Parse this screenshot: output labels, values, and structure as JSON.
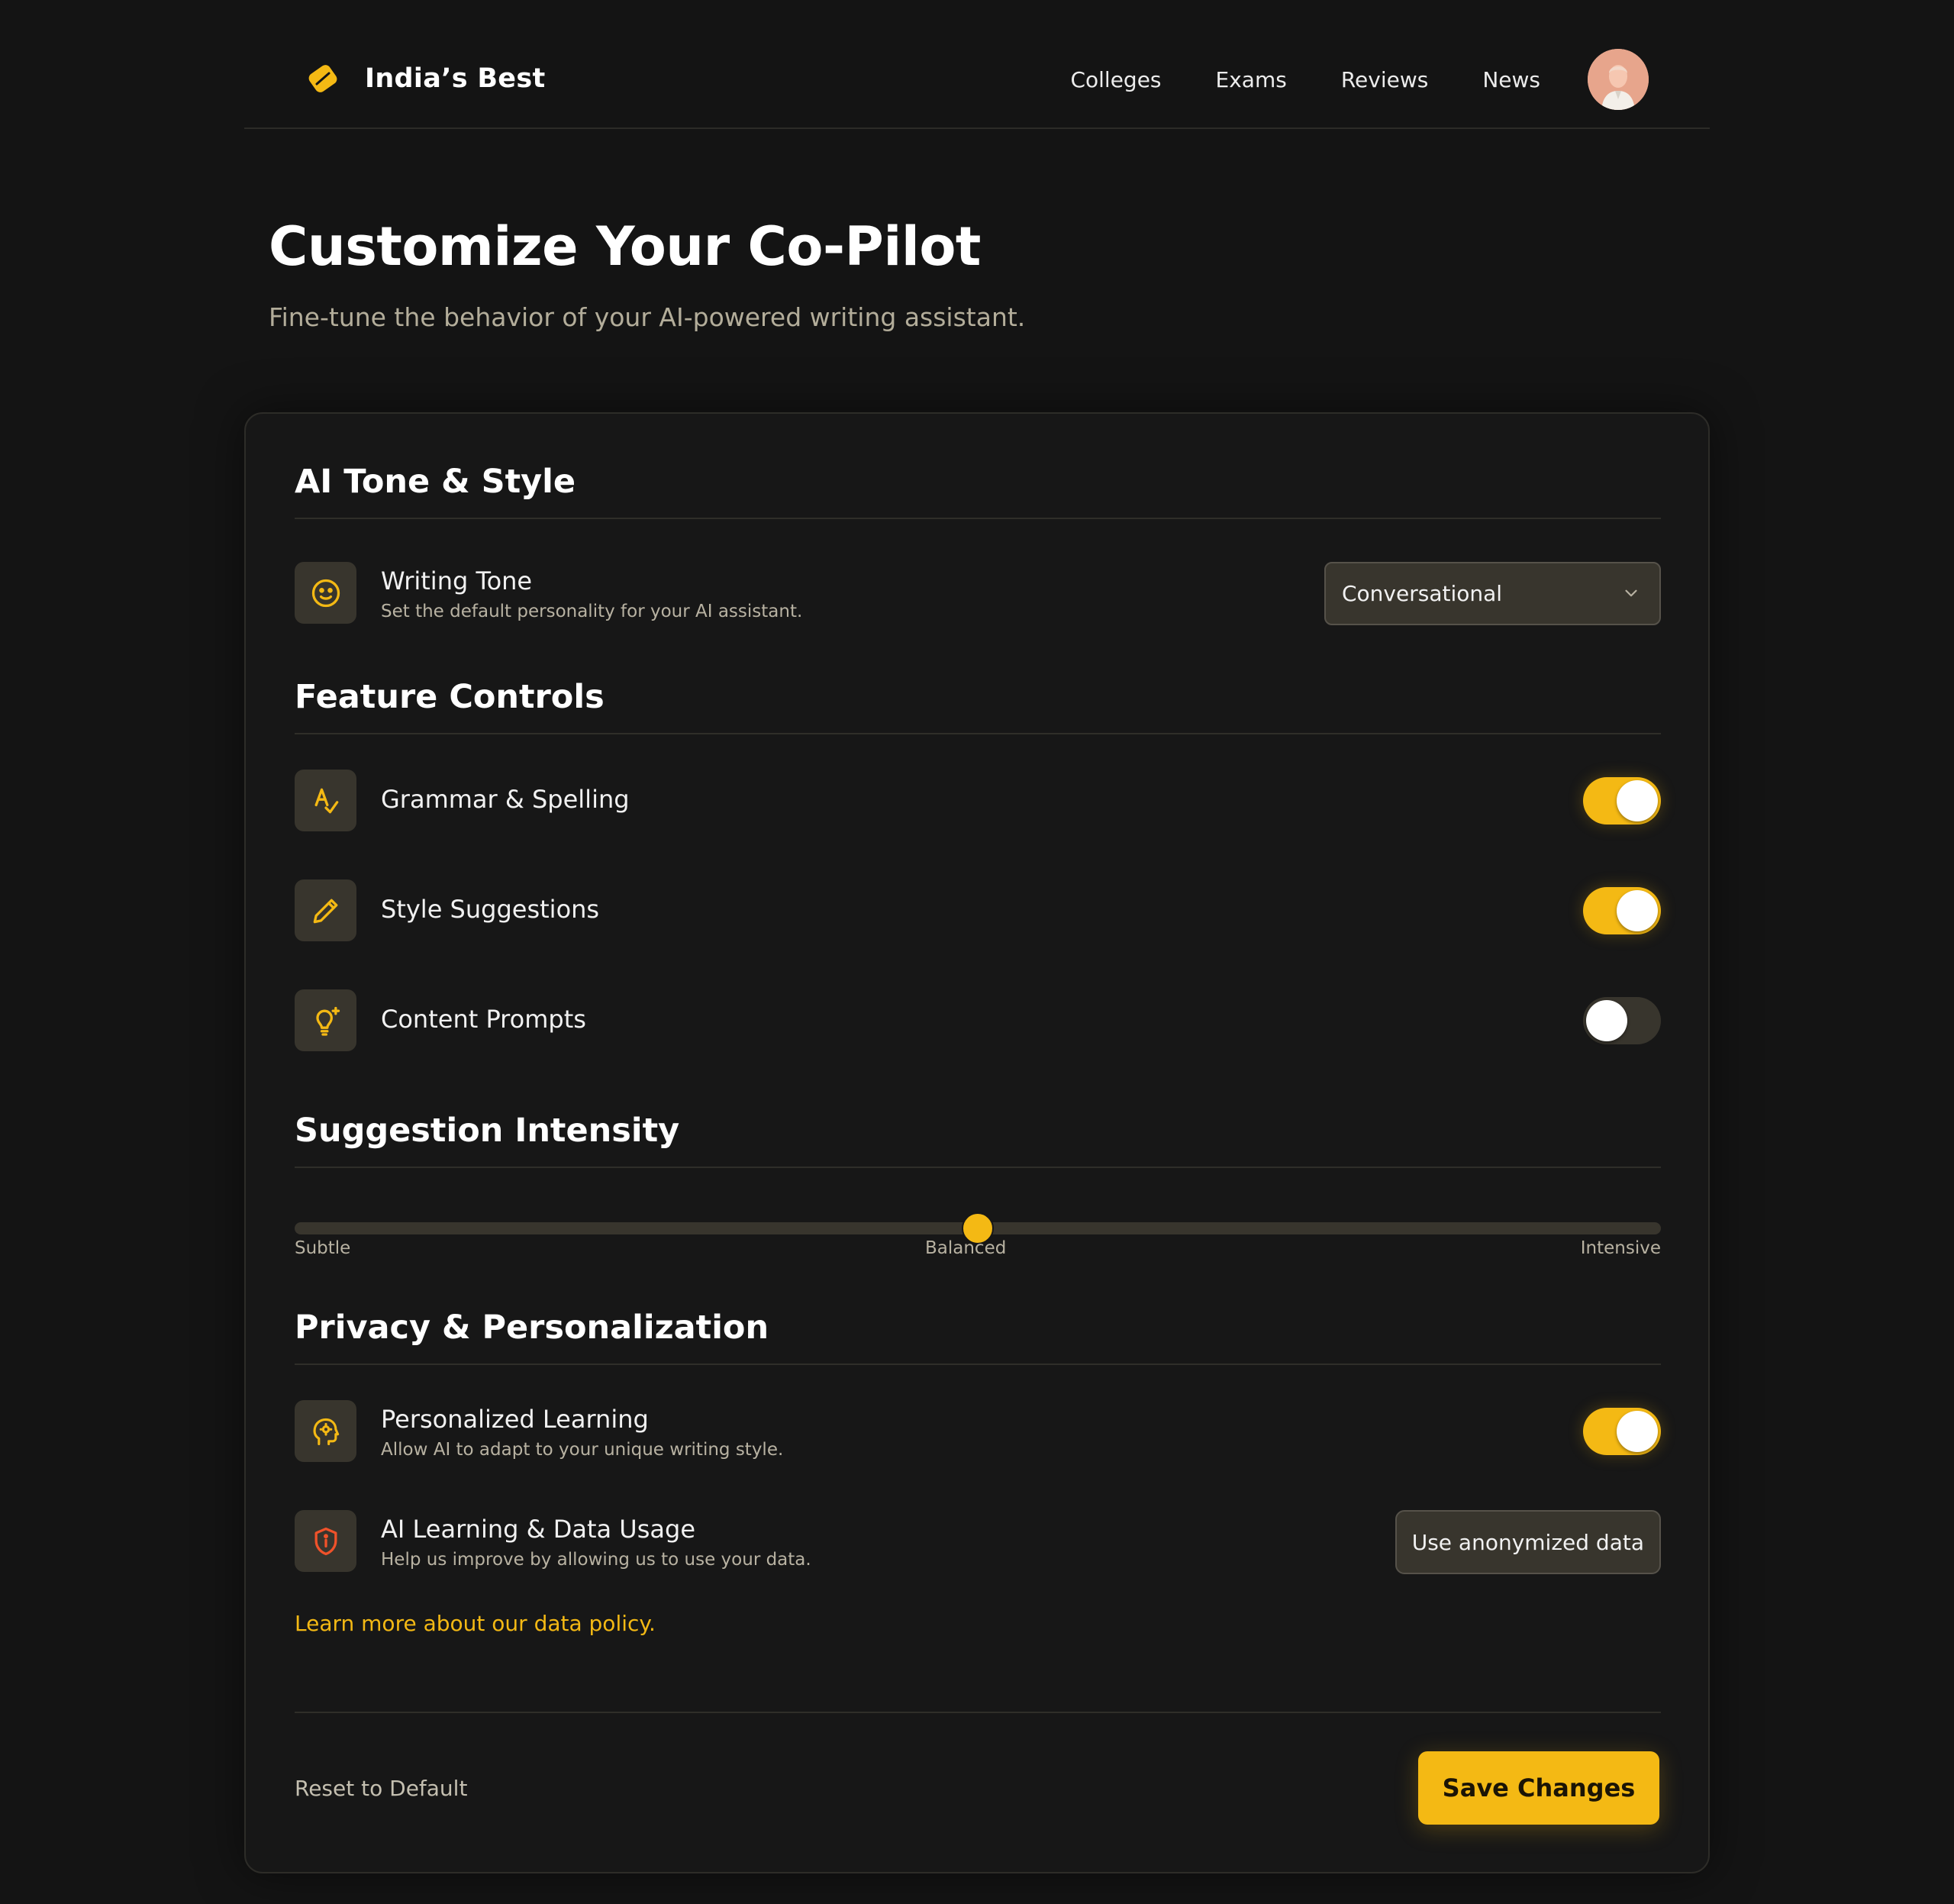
{
  "brand": {
    "name": "India’s Best"
  },
  "nav": {
    "links": [
      "Colleges",
      "Exams",
      "Reviews",
      "News"
    ]
  },
  "hero": {
    "title": "Customize Your Co-Pilot",
    "subtitle": "Fine-tune the behavior of your AI-powered writing assistant."
  },
  "sections": {
    "tone": {
      "title": "AI Tone & Style",
      "writing_tone": {
        "label": "Writing Tone",
        "description": "Set the default personality for your AI assistant.",
        "selected": "Conversational",
        "icon": "smile-icon"
      }
    },
    "features": {
      "title": "Feature Controls",
      "items": [
        {
          "label": "Grammar & Spelling",
          "enabled": true,
          "icon": "spellcheck-icon"
        },
        {
          "label": "Style Suggestions",
          "enabled": true,
          "icon": "pencil-icon"
        },
        {
          "label": "Content Prompts",
          "enabled": false,
          "icon": "lightbulb-sparkle-icon"
        }
      ]
    },
    "intensity": {
      "title": "Suggestion Intensity",
      "labels": [
        "Subtle",
        "Balanced",
        "Intensive"
      ],
      "value_fraction": 0.5
    },
    "privacy": {
      "title": "Privacy & Personalization",
      "personalized": {
        "label": "Personalized Learning",
        "description": "Allow AI to adapt to your unique writing style.",
        "enabled": true,
        "icon": "brain-head-icon"
      },
      "data_usage": {
        "label": "AI Learning & Data Usage",
        "description": "Help us improve by allowing us to use your data.",
        "button": "Use anonymized data",
        "icon": "shield-info-icon"
      },
      "policy_link": "Learn more about our data policy."
    }
  },
  "footer": {
    "reset": "Reset to Default",
    "save": "Save Changes"
  },
  "colors": {
    "accent": "#f4b914",
    "background": "#141414",
    "card": "#171717",
    "warning": "#f0522a"
  }
}
